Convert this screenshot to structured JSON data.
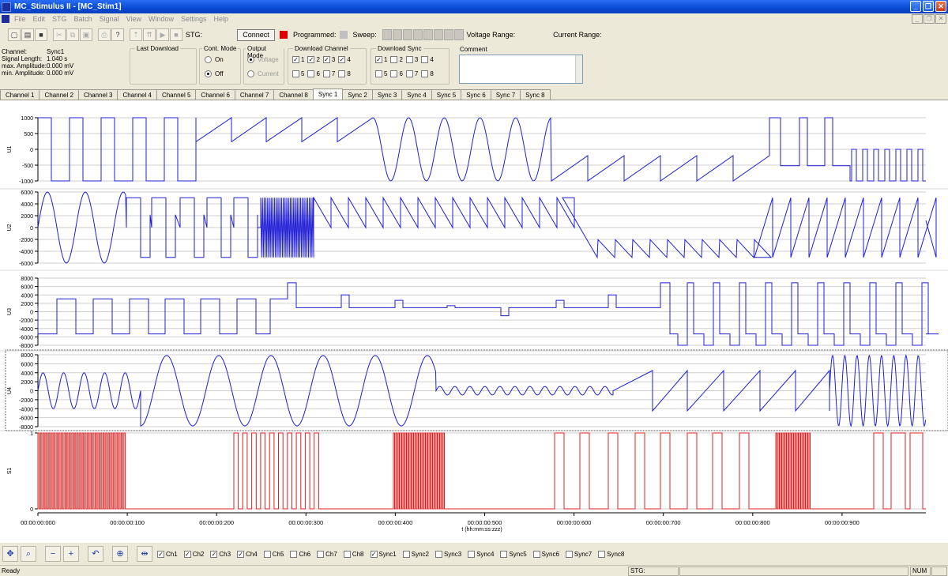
{
  "window": {
    "title": "MC_Stimulus II - [MC_Stim1]"
  },
  "menu": [
    "File",
    "Edit",
    "STG",
    "Batch",
    "Signal",
    "View",
    "Window",
    "Settings",
    "Help"
  ],
  "toolbar": {
    "stg_label": "STG:",
    "connect_label": "Connect",
    "programmed_label": "Programmed:",
    "sweep_label": "Sweep:",
    "voltage_range_label": "Voltage Range:",
    "current_range_label": "Current Range:",
    "programmed_color": "#e00000",
    "sweep_color": "#c0c0c0"
  },
  "info": {
    "channel_key": "Channel:",
    "channel_val": "Sync1",
    "length_key": "Signal Length:",
    "length_val": "1.040 s",
    "maxamp_key": "max. Amplitude:",
    "maxamp_val": "0.000 mV",
    "minamp_key": "min. Amplitude:",
    "minamp_val": "0.000 mV"
  },
  "groups": {
    "last_download": "Last Download",
    "cont_mode": "Cont. Mode",
    "cont_on": "On",
    "cont_off": "Off",
    "output_mode": "Output Mode",
    "out_voltage": "Voltage",
    "out_current": "Current",
    "download_channel": "Download Channel",
    "download_sync": "Download Sync",
    "comment": "Comment"
  },
  "download_channel": [
    {
      "label": "1",
      "checked": true
    },
    {
      "label": "2",
      "checked": true
    },
    {
      "label": "3",
      "checked": true
    },
    {
      "label": "4",
      "checked": true
    },
    {
      "label": "5",
      "checked": false
    },
    {
      "label": "6",
      "checked": false
    },
    {
      "label": "7",
      "checked": false
    },
    {
      "label": "8",
      "checked": false
    }
  ],
  "download_sync": [
    {
      "label": "1",
      "checked": true
    },
    {
      "label": "2",
      "checked": false
    },
    {
      "label": "3",
      "checked": false
    },
    {
      "label": "4",
      "checked": false
    },
    {
      "label": "5",
      "checked": false
    },
    {
      "label": "6",
      "checked": false
    },
    {
      "label": "7",
      "checked": false
    },
    {
      "label": "8",
      "checked": false
    }
  ],
  "tabs": [
    "Channel 1",
    "Channel 2",
    "Channel 3",
    "Channel 4",
    "Channel 5",
    "Channel 6",
    "Channel 7",
    "Channel 8",
    "Sync 1",
    "Sync 2",
    "Sync 3",
    "Sync 4",
    "Sync 5",
    "Sync 6",
    "Sync 7",
    "Sync 8"
  ],
  "active_tab": "Sync 1",
  "plots": [
    {
      "label": "U1",
      "ticks": [
        "1000",
        "500",
        "0",
        "-500",
        "-1000"
      ],
      "color": "#1f1fd6"
    },
    {
      "label": "U2",
      "ticks": [
        "6000",
        "4000",
        "2000",
        "0",
        "-2000",
        "-4000",
        "-6000"
      ],
      "color": "#1f1fd6"
    },
    {
      "label": "U3",
      "ticks": [
        "8000",
        "6000",
        "4000",
        "2000",
        "0",
        "-2000",
        "-4000",
        "-6000",
        "-8000"
      ],
      "color": "#1f1fd6"
    },
    {
      "label": "U4",
      "ticks": [
        "8000",
        "6000",
        "4000",
        "2000",
        "0",
        "-2000",
        "-4000",
        "-6000",
        "-8000"
      ],
      "color": "#1f1fd6"
    },
    {
      "label": "S1",
      "ticks": [
        "1",
        "0"
      ],
      "color": "#e02020"
    }
  ],
  "time_axis": {
    "ticks": [
      "00:00:00:000",
      "00:00:00:100",
      "00:00:00:200",
      "00:00:00:300",
      "00:00:00:400",
      "00:00:00:500",
      "00:00:00:600",
      "00:00:00:700",
      "00:00:00:800",
      "00:00:00:900"
    ],
    "label": "t (hh:mm:ss:zzz)"
  },
  "bottom_checks": [
    {
      "label": "Ch1",
      "checked": true
    },
    {
      "label": "Ch2",
      "checked": true
    },
    {
      "label": "Ch3",
      "checked": true
    },
    {
      "label": "Ch4",
      "checked": true
    },
    {
      "label": "Ch5",
      "checked": false
    },
    {
      "label": "Ch6",
      "checked": false
    },
    {
      "label": "Ch7",
      "checked": false
    },
    {
      "label": "Ch8",
      "checked": false
    },
    {
      "label": "Sync1",
      "checked": true
    },
    {
      "label": "Sync2",
      "checked": false
    },
    {
      "label": "Sync3",
      "checked": false
    },
    {
      "label": "Sync4",
      "checked": false
    },
    {
      "label": "Sync5",
      "checked": false
    },
    {
      "label": "Sync6",
      "checked": false
    },
    {
      "label": "Sync7",
      "checked": false
    },
    {
      "label": "Sync8",
      "checked": false
    }
  ],
  "status": {
    "ready": "Ready",
    "stg": "STG:",
    "num": "NUM"
  }
}
